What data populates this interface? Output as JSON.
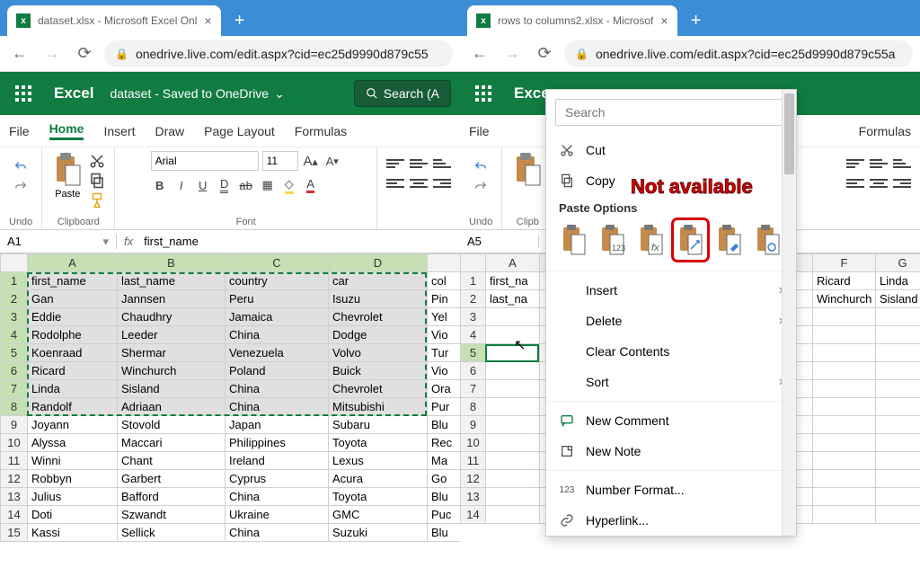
{
  "left": {
    "tab_title": "dataset.xlsx - Microsoft Excel Onl",
    "url_display": "onedrive.live.com/edit.aspx?cid=ec25d9990d879c55",
    "brand": "Excel",
    "doc_status": "dataset  - Saved to OneDrive",
    "search_label": "Search (A",
    "ribbon_tabs": [
      "File",
      "Home",
      "Insert",
      "Draw",
      "Page Layout",
      "Formulas"
    ],
    "active_tab": "Home",
    "undo_label": "Undo",
    "paste_label": "Paste",
    "clipboard_label": "Clipboard",
    "font_name": "Arial",
    "font_size": "11",
    "font_label": "Font",
    "namebox": "A1",
    "formula_value": "first_name",
    "columns": [
      "A",
      "B",
      "C",
      "D",
      ""
    ],
    "rows": [
      {
        "n": 1,
        "cells": [
          "first_name",
          "last_name",
          "country",
          "car",
          "col"
        ],
        "sel": true
      },
      {
        "n": 2,
        "cells": [
          "Gan",
          "Jannsen",
          "Peru",
          "Isuzu",
          "Pin"
        ],
        "sel": true
      },
      {
        "n": 3,
        "cells": [
          "Eddie",
          "Chaudhry",
          "Jamaica",
          "Chevrolet",
          "Yel"
        ],
        "sel": true
      },
      {
        "n": 4,
        "cells": [
          "Rodolphe",
          "Leeder",
          "China",
          "Dodge",
          "Vio"
        ],
        "sel": true
      },
      {
        "n": 5,
        "cells": [
          "Koenraad",
          "Shermar",
          "Venezuela",
          "Volvo",
          "Tur"
        ],
        "sel": true
      },
      {
        "n": 6,
        "cells": [
          "Ricard",
          "Winchurch",
          "Poland",
          "Buick",
          "Vio"
        ],
        "sel": true
      },
      {
        "n": 7,
        "cells": [
          "Linda",
          "Sisland",
          "China",
          "Chevrolet",
          "Ora"
        ],
        "sel": true
      },
      {
        "n": 8,
        "cells": [
          "Randolf",
          "Adriaan",
          "China",
          "Mitsubishi",
          "Pur"
        ],
        "sel": true
      },
      {
        "n": 9,
        "cells": [
          "Joyann",
          "Stovold",
          "Japan",
          "Subaru",
          "Blu"
        ],
        "sel": false
      },
      {
        "n": 10,
        "cells": [
          "Alyssa",
          "Maccari",
          "Philippines",
          "Toyota",
          "Rec"
        ],
        "sel": false
      },
      {
        "n": 11,
        "cells": [
          "Winni",
          "Chant",
          "Ireland",
          "Lexus",
          "Ma"
        ],
        "sel": false
      },
      {
        "n": 12,
        "cells": [
          "Robbyn",
          "Garbert",
          "Cyprus",
          "Acura",
          "Go"
        ],
        "sel": false
      },
      {
        "n": 13,
        "cells": [
          "Julius",
          "Bafford",
          "China",
          "Toyota",
          "Blu"
        ],
        "sel": false
      },
      {
        "n": 14,
        "cells": [
          "Doti",
          "Szwandt",
          "Ukraine",
          "GMC",
          "Puc"
        ],
        "sel": false
      },
      {
        "n": 15,
        "cells": [
          "Kassi",
          "Sellick",
          "China",
          "Suzuki",
          "Blu"
        ],
        "sel": false
      }
    ]
  },
  "right": {
    "tab_title": "rows to columns2.xlsx - Microsof",
    "url_display": "onedrive.live.com/edit.aspx?cid=ec25d9990d879c55a",
    "brand": "Exce",
    "ribbon_tabs": [
      "File"
    ],
    "formulas_tab": "Formulas",
    "undo_label": "Undo",
    "clipboard_label": "Clipb",
    "namebox": "A5",
    "columns": [
      "A",
      "F",
      "G"
    ],
    "far_cells": {
      "F2": "Ricard",
      "G2": "Linda",
      "F3": "Winchurch",
      "G3": "Sisland"
    },
    "rows": [
      {
        "n": 1,
        "a": "first_na"
      },
      {
        "n": 2,
        "a": "last_na"
      },
      {
        "n": 3,
        "a": ""
      },
      {
        "n": 4,
        "a": ""
      },
      {
        "n": 5,
        "a": ""
      },
      {
        "n": 6,
        "a": ""
      },
      {
        "n": 7,
        "a": ""
      },
      {
        "n": 8,
        "a": ""
      },
      {
        "n": 9,
        "a": ""
      },
      {
        "n": 10,
        "a": ""
      },
      {
        "n": 11,
        "a": ""
      },
      {
        "n": 12,
        "a": ""
      },
      {
        "n": 13,
        "a": ""
      },
      {
        "n": 14,
        "a": ""
      }
    ],
    "ctx": {
      "search_placeholder": "Search",
      "cut": "Cut",
      "copy": "Copy",
      "paste_options": "Paste Options",
      "insert": "Insert",
      "delete": "Delete",
      "clear": "Clear Contents",
      "sort": "Sort",
      "new_comment": "New Comment",
      "new_note": "New Note",
      "number_format": "Number Format...",
      "hyperlink": "Hyperlink..."
    },
    "annotation": "Not available"
  }
}
